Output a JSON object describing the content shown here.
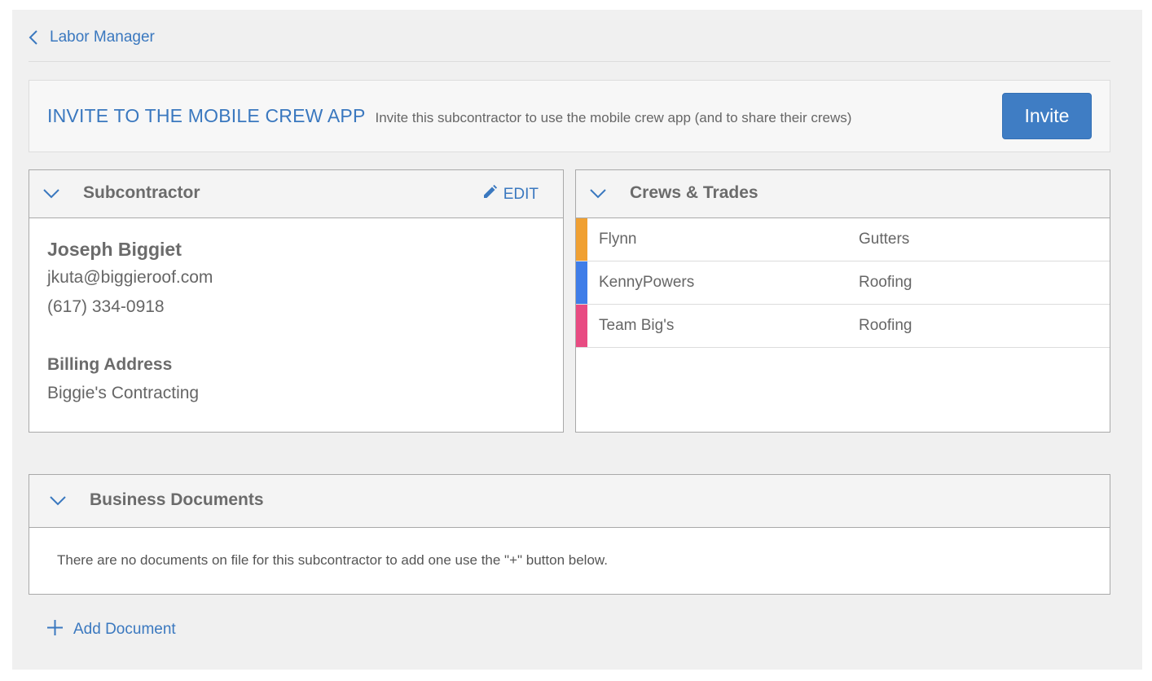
{
  "breadcrumb": {
    "label": "Labor Manager"
  },
  "invite": {
    "title": "INVITE TO THE MOBILE CREW APP",
    "description": "Invite this subcontractor to use the mobile crew app (and to share their crews)",
    "button_label": "Invite"
  },
  "subcontractor": {
    "title": "Subcontractor",
    "edit_label": "EDIT",
    "name": "Joseph Biggiet",
    "email": "jkuta@biggieroof.com",
    "phone": "(617) 334-0918",
    "billing_title": "Billing Address",
    "billing_name": "Biggie's Contracting"
  },
  "crews": {
    "title": "Crews & Trades",
    "rows": [
      {
        "name": "Flynn",
        "trade": "Gutters",
        "color": "#f0a032"
      },
      {
        "name": "KennyPowers",
        "trade": "Roofing",
        "color": "#3f7de8"
      },
      {
        "name": "Team Big's",
        "trade": "Roofing",
        "color": "#e84b82"
      }
    ]
  },
  "documents": {
    "title": "Business Documents",
    "empty_message": "There are no documents on file for this subcontractor to add one use the \"+\" button below.",
    "add_label": "Add Document"
  },
  "colors": {
    "accent": "#3a78bf",
    "button": "#3f7dc4"
  },
  "icons": [
    "chevron-left-icon",
    "chevron-down-icon",
    "pencil-icon",
    "plus-icon"
  ]
}
